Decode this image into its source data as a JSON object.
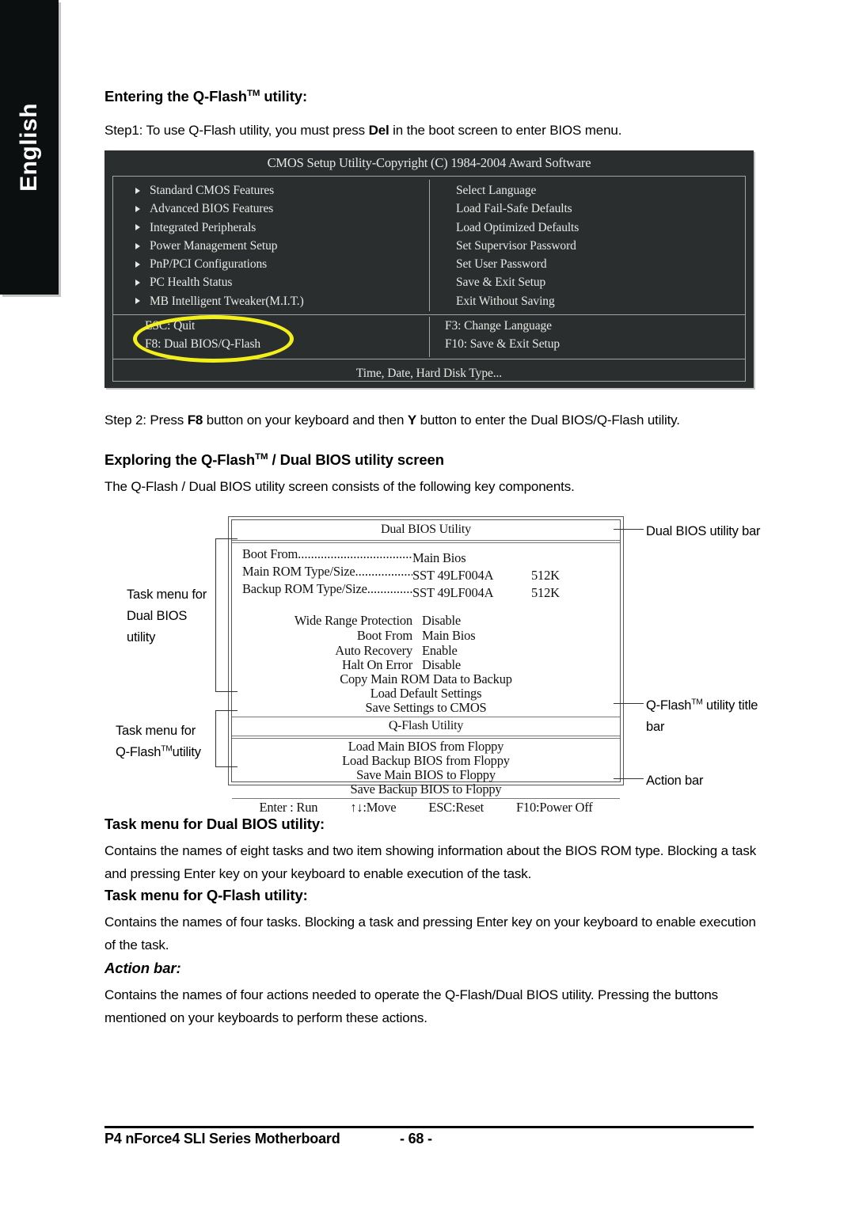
{
  "sidebar": {
    "language_tab": "English"
  },
  "sections": {
    "entering_heading_pre": "Entering the Q-Flash",
    "entering_heading_tm": "TM",
    "entering_heading_post": " utility:",
    "step1": {
      "pre": "Step1: To use Q-Flash utility, you must press ",
      "bold": "Del",
      "post": " in the boot screen to enter BIOS menu."
    },
    "step2": {
      "pre": "Step 2: Press ",
      "bold1": "F8",
      "mid": " button on your keyboard and then ",
      "bold2": "Y",
      "post": " button to enter the Dual BIOS/Q-Flash utility."
    },
    "exploring_heading_pre": "Exploring the Q-Flash",
    "exploring_heading_tm": "TM",
    "exploring_heading_post": " / Dual BIOS utility screen",
    "exploring_body": "The Q-Flash / Dual BIOS utility screen consists of the following key components.",
    "task_dualbios_heading": "Task menu for Dual BIOS utility:",
    "task_dualbios_body": "Contains the names of eight tasks and two item showing information about the BIOS ROM type. Blocking a task and pressing Enter key on your keyboard to enable execution of the task.",
    "task_qflash_heading": "Task menu for Q-Flash utility:",
    "task_qflash_body": "Contains the names of four tasks. Blocking a task and pressing Enter key on your keyboard to enable execution of the task.",
    "action_bar_heading": "Action bar:",
    "action_bar_body": "Contains the names of four actions needed to operate the Q-Flash/Dual BIOS utility. Pressing the buttons mentioned on your keyboards to perform these actions."
  },
  "bios_screen": {
    "title": "CMOS Setup Utility-Copyright (C) 1984-2004 Award Software",
    "left_menu": [
      "Standard CMOS Features",
      "Advanced BIOS Features",
      "Integrated Peripherals",
      "Power Management Setup",
      "PnP/PCI Configurations",
      "PC Health Status",
      "MB Intelligent Tweaker(M.I.T.)"
    ],
    "right_menu": [
      "Select Language",
      "Load Fail-Safe Defaults",
      "Load Optimized Defaults",
      "Set Supervisor Password",
      "Set User Password",
      "Save & Exit Setup",
      "Exit Without Saving"
    ],
    "keys": {
      "esc": "ESC: Quit",
      "f8": "F8: Dual BIOS/Q-Flash",
      "f3": "F3: Change Language",
      "f10": "F10: Save & Exit Setup"
    },
    "hint": "Time, Date, Hard Disk Type...",
    "highlight_color": "#f2ef1a",
    "background_color": "#2a2e2f",
    "text_color": "#e9e9e4"
  },
  "diagram": {
    "dual_bios_bar_title": "Dual BIOS Utility",
    "rom_rows": [
      {
        "label": "Boot From",
        "dots": "......................................",
        "value": "Main Bios",
        "size": ""
      },
      {
        "label": "Main ROM Type/Size",
        "dots": ".......................",
        "value": "SST 49LF004A",
        "size": "512K"
      },
      {
        "label": "Backup ROM Type/Size",
        "dots": "..................",
        "value": "SST 49LF004A",
        "size": "512K"
      }
    ],
    "dual_bios_tasks": [
      {
        "label": "Wide Range Protection",
        "value": "Disable"
      },
      {
        "label": "Boot From",
        "value": "Main Bios"
      },
      {
        "label": "Auto Recovery",
        "value": "Enable"
      },
      {
        "label": "Halt On Error",
        "value": "Disable"
      }
    ],
    "dual_bios_actions": [
      "Copy Main ROM Data to Backup",
      "Load Default Settings",
      "Save Settings to CMOS"
    ],
    "qflash_bar_title": "Q-Flash Utility",
    "qflash_tasks": [
      "Load Main BIOS from Floppy",
      "Load Backup BIOS from Floppy",
      "Save Main BIOS to Floppy",
      "Save Backup BIOS to Floppy"
    ],
    "action_bar": [
      "Enter : Run",
      "↑↓:Move",
      "ESC:Reset",
      "F10:Power Off"
    ],
    "callouts": {
      "dual_bios_utility_bar": "Dual BIOS utility bar",
      "qflash_title_bar_line1_pre": "Q-Flash",
      "qflash_title_bar_line1_tm": "TM",
      "qflash_title_bar_line1_post": " utility title",
      "qflash_title_bar_line2": "bar",
      "action_bar": "Action bar",
      "task_dualbios_line1": "Task menu for",
      "task_dualbios_line2": "Dual BIOS",
      "task_dualbios_line3": "utility",
      "task_qflash_line1": "Task menu for",
      "task_qflash_line2_pre": "Q-Flash",
      "task_qflash_line2_tm": "TM",
      "task_qflash_line2_post": "utility"
    }
  },
  "footer": {
    "product": "P4 nForce4 SLI Series Motherboard",
    "page": "- 68 -"
  }
}
